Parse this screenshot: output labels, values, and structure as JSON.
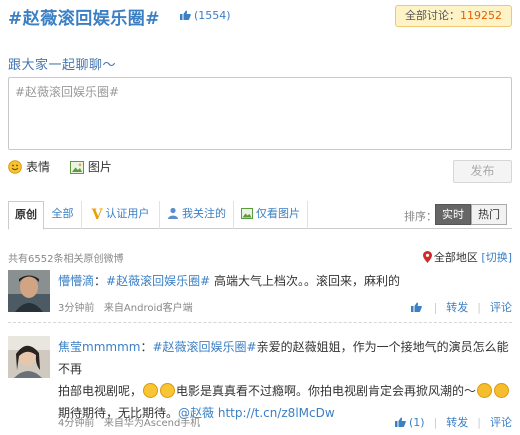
{
  "header": {
    "title": "#赵薇滚回娱乐圈#",
    "like_count": "(1554)",
    "total_label": "全部讨论：",
    "total_count": "119252"
  },
  "compose": {
    "prompt": "跟大家一起聊聊～",
    "content": "#赵薇滚回娱乐圈#",
    "emoji_label": "表情",
    "image_label": "图片",
    "send_label": "发布"
  },
  "tabs": {
    "original": "原创",
    "all": "全部",
    "verified": "认证用户",
    "following": "我关注的",
    "images_only": "仅看图片",
    "sort_label": "排序：",
    "realtime": "实时",
    "hot": "热门"
  },
  "feed": {
    "summary": "共有6552条相关原创微博",
    "region": "全部地区",
    "switch": "[切换]"
  },
  "posts": [
    {
      "author": "懵懵滴",
      "topic": "#赵薇滚回娱乐圈#",
      "text": " 高端大气上档次。。滚回来，麻利的",
      "time": "3分钟前",
      "source": "来自Android客户端",
      "like": "",
      "repost": "转发",
      "comment": "评论"
    },
    {
      "author": "焦莹mmmmm",
      "topic": "#赵薇滚回娱乐圈#",
      "text_1": "亲爱的赵薇姐姐，作为一个接地气的演员怎么能不再",
      "text_2": "拍部电视剧呢，",
      "text_3": "电影是真真看不过瘾啊。你拍电视剧肯定会再掀风潮的～",
      "text_4": "期待期待，无比期待。",
      "mention": "@赵薇",
      "url": "http://t.cn/z8lMcDw",
      "time": "4分钟前",
      "source": "来自华为Ascend手机",
      "like": "(1)",
      "repost": "转发",
      "comment": "评论"
    }
  ],
  "colors": {
    "link": "#3b7fc4",
    "count_orange": "#e55f00",
    "total_bg": "#fdf3c6"
  }
}
